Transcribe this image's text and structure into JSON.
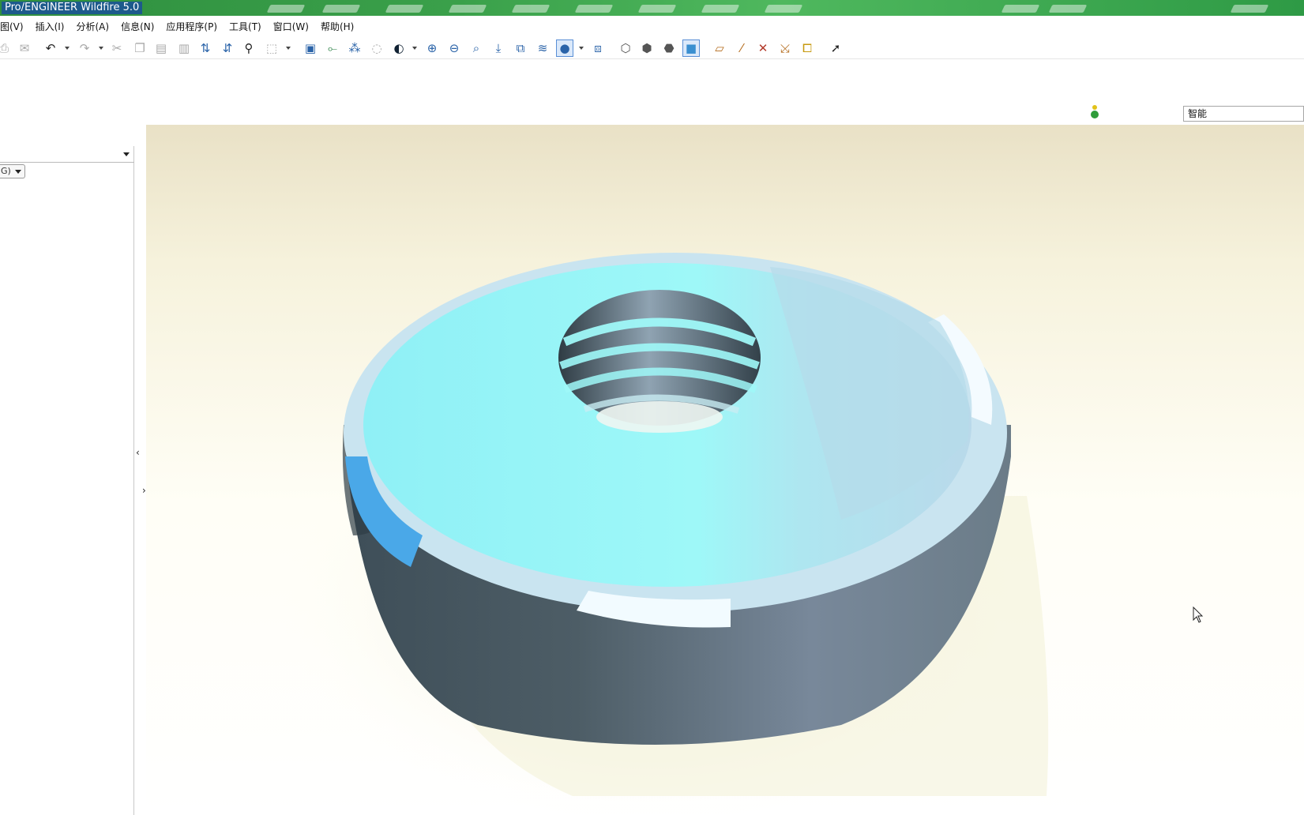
{
  "window": {
    "title": "Pro/ENGINEER Wildfire 5.0"
  },
  "menu": {
    "items": [
      "图(V)",
      "插入(I)",
      "分析(A)",
      "信息(N)",
      "应用程序(P)",
      "工具(T)",
      "窗口(W)",
      "帮助(H)"
    ]
  },
  "toolbar": {
    "buttons": [
      "undo-icon",
      "redo-icon",
      "cut-icon",
      "copy-icon",
      "paste-icon",
      "paste-special-icon",
      "regenerate-icon",
      "regenerate-manager-icon",
      "find-icon",
      "select-box-icon",
      "sketch-datum-icon",
      "datum-axis-icon",
      "datum-point-icon",
      "orient-icon",
      "shading-icon",
      "zoom-in-icon",
      "zoom-out-icon",
      "refit-icon",
      "reorient-icon",
      "saved-views-icon",
      "layers-icon",
      "appearance-icon",
      "view-manager-icon",
      "wireframe-icon",
      "hidden-line-icon",
      "no-hidden-icon",
      "shaded-icon",
      "datum-planes-icon",
      "datum-axes-icon",
      "point-display-icon",
      "csys-display-icon",
      "annotation-display-icon",
      "context-help-icon"
    ]
  },
  "filter": {
    "value": "智能"
  },
  "model_tree": {
    "combo_value": "",
    "small_combo_text": "G)"
  },
  "colors": {
    "top_face": "#9ff8f8",
    "side_face": "#6a7a85",
    "titlebar": "#3aa04a",
    "viewport_bg": "#f6f2dc"
  }
}
